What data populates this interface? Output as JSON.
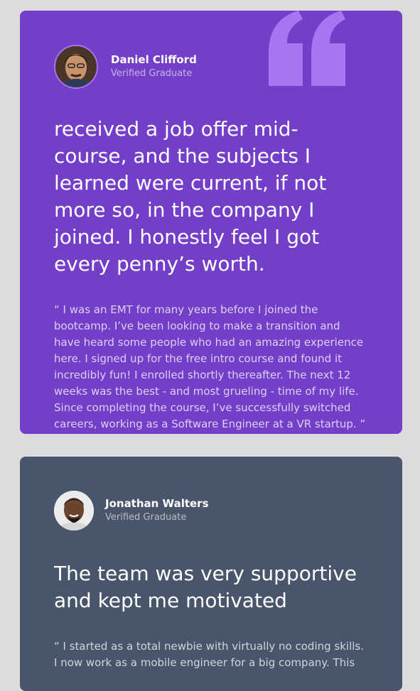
{
  "testimonials": [
    {
      "name": "Daniel Clifford",
      "role": "Verified Graduate",
      "headline": "received a job offer mid-course, and the subjects I learned were current, if not more so, in the company I joined. I honestly feel I got every penny’s worth.",
      "quote": "“ I was an EMT for many years before I joined the bootcamp. I’ve been looking to make a transition and have heard some people who had an amazing experience here. I signed up for the free intro course and found it incredibly fun! I enrolled shortly thereafter. The next 12 weeks was the best - and most grueling - time of my life. Since completing the course, I’ve successfully switched careers, working as a Software Engineer at a VR startup. ”",
      "background": "#733fc8",
      "avatar_border": "#a775f1",
      "icon": "quote-icon"
    },
    {
      "name": "Jonathan Walters",
      "role": "Verified Graduate",
      "headline": "The team was very supportive and kept me motivated",
      "quote": "“ I started as a total newbie with virtually no coding skills. I now work as a mobile engineer for a big company. This",
      "background": "#48556a"
    }
  ]
}
